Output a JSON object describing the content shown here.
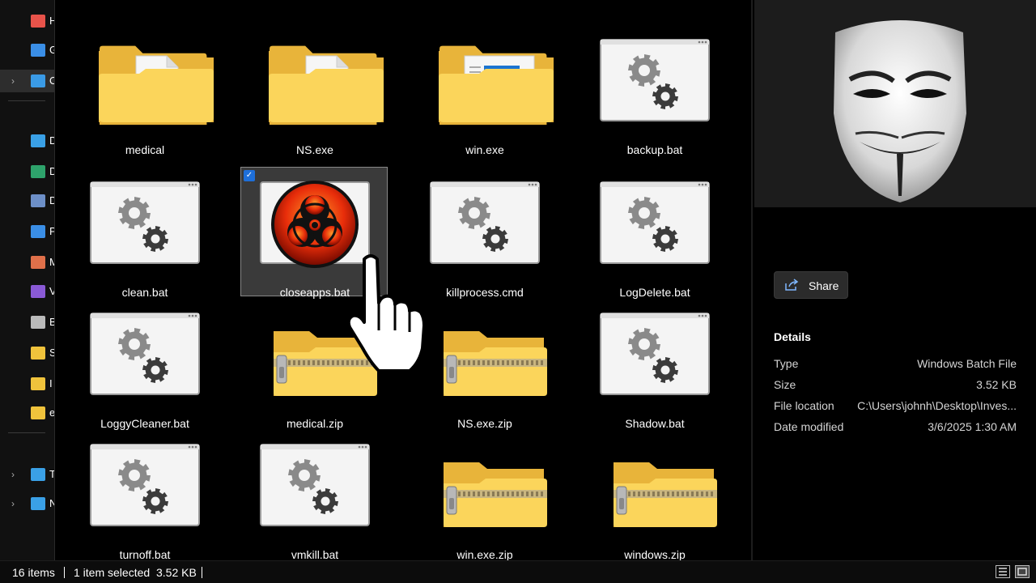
{
  "nav": {
    "items": [
      {
        "label": "Home",
        "icon": "home-icon",
        "color": "#e8534a",
        "chevron": false
      },
      {
        "label": "Gallery",
        "icon": "gallery-icon",
        "color": "#3a8ee6",
        "chevron": false
      },
      {
        "label": "OneDrive",
        "icon": "cloud-icon",
        "color": "#3a9be6",
        "chevron": true,
        "selected": true
      },
      {
        "label": "Desktop",
        "icon": "desktop-icon",
        "color": "#3aa0e6",
        "chevron": false
      },
      {
        "label": "Downloads",
        "icon": "download-icon",
        "color": "#2ea36b",
        "chevron": false
      },
      {
        "label": "Documents",
        "icon": "documents-icon",
        "color": "#6d8fc7",
        "chevron": false
      },
      {
        "label": "Pictures",
        "icon": "pictures-icon",
        "color": "#3a8ee6",
        "chevron": false
      },
      {
        "label": "Music",
        "icon": "music-icon",
        "color": "#e0704a",
        "chevron": false
      },
      {
        "label": "Videos",
        "icon": "videos-icon",
        "color": "#8a5ad6",
        "chevron": false
      },
      {
        "label": "Backup",
        "icon": "drive-icon",
        "color": "#bbbbbb",
        "chevron": false
      },
      {
        "label": "S",
        "icon": "folder-icon",
        "color": "#f0c33c",
        "chevron": false
      },
      {
        "label": "I",
        "icon": "folder-icon",
        "color": "#f0c33c",
        "chevron": false
      },
      {
        "label": "e",
        "icon": "folder-icon",
        "color": "#f0c33c",
        "chevron": false
      },
      {
        "label": "This PC",
        "icon": "pc-icon",
        "color": "#3aa0e6",
        "chevron": true
      },
      {
        "label": "Network",
        "icon": "network-icon",
        "color": "#3aa0e6",
        "chevron": true
      }
    ]
  },
  "files": [
    {
      "name": "medical",
      "kind": "folder-doc"
    },
    {
      "name": "NS.exe",
      "kind": "folder-doc"
    },
    {
      "name": "win.exe",
      "kind": "folder-window"
    },
    {
      "name": "backup.bat",
      "kind": "batch"
    },
    {
      "name": "clean.bat",
      "kind": "batch"
    },
    {
      "name": "closeapps.bat",
      "kind": "biohazard",
      "selected": true
    },
    {
      "name": "killprocess.cmd",
      "kind": "batch"
    },
    {
      "name": "LogDelete.bat",
      "kind": "batch"
    },
    {
      "name": "LoggyCleaner.bat",
      "kind": "batch"
    },
    {
      "name": "medical.zip",
      "kind": "zip"
    },
    {
      "name": "NS.exe.zip",
      "kind": "zip"
    },
    {
      "name": "Shadow.bat",
      "kind": "batch"
    },
    {
      "name": "turnoff.bat",
      "kind": "batch"
    },
    {
      "name": "vmkill.bat",
      "kind": "batch"
    },
    {
      "name": "win.exe.zip",
      "kind": "zip"
    },
    {
      "name": "windows.zip",
      "kind": "zip"
    }
  ],
  "details": {
    "share_label": "Share",
    "title": "Details",
    "properties": [
      {
        "key": "Type",
        "value": "Windows Batch File"
      },
      {
        "key": "Size",
        "value": "3.52 KB"
      },
      {
        "key": "File location",
        "value": "C:\\Users\\johnh\\Desktop\\Inves..."
      },
      {
        "key": "Date modified",
        "value": "3/6/2025 1:30 AM"
      }
    ]
  },
  "status": {
    "item_count": "16 items",
    "selection": "1 item selected",
    "selection_size": "3.52 KB"
  },
  "colors": {
    "folder_back": "#e8b43a",
    "folder_front": "#fbd55b",
    "selection_check": "#1e6fd9",
    "gear_light": "#8a8a8a",
    "gear_dark": "#3b3b3b"
  }
}
